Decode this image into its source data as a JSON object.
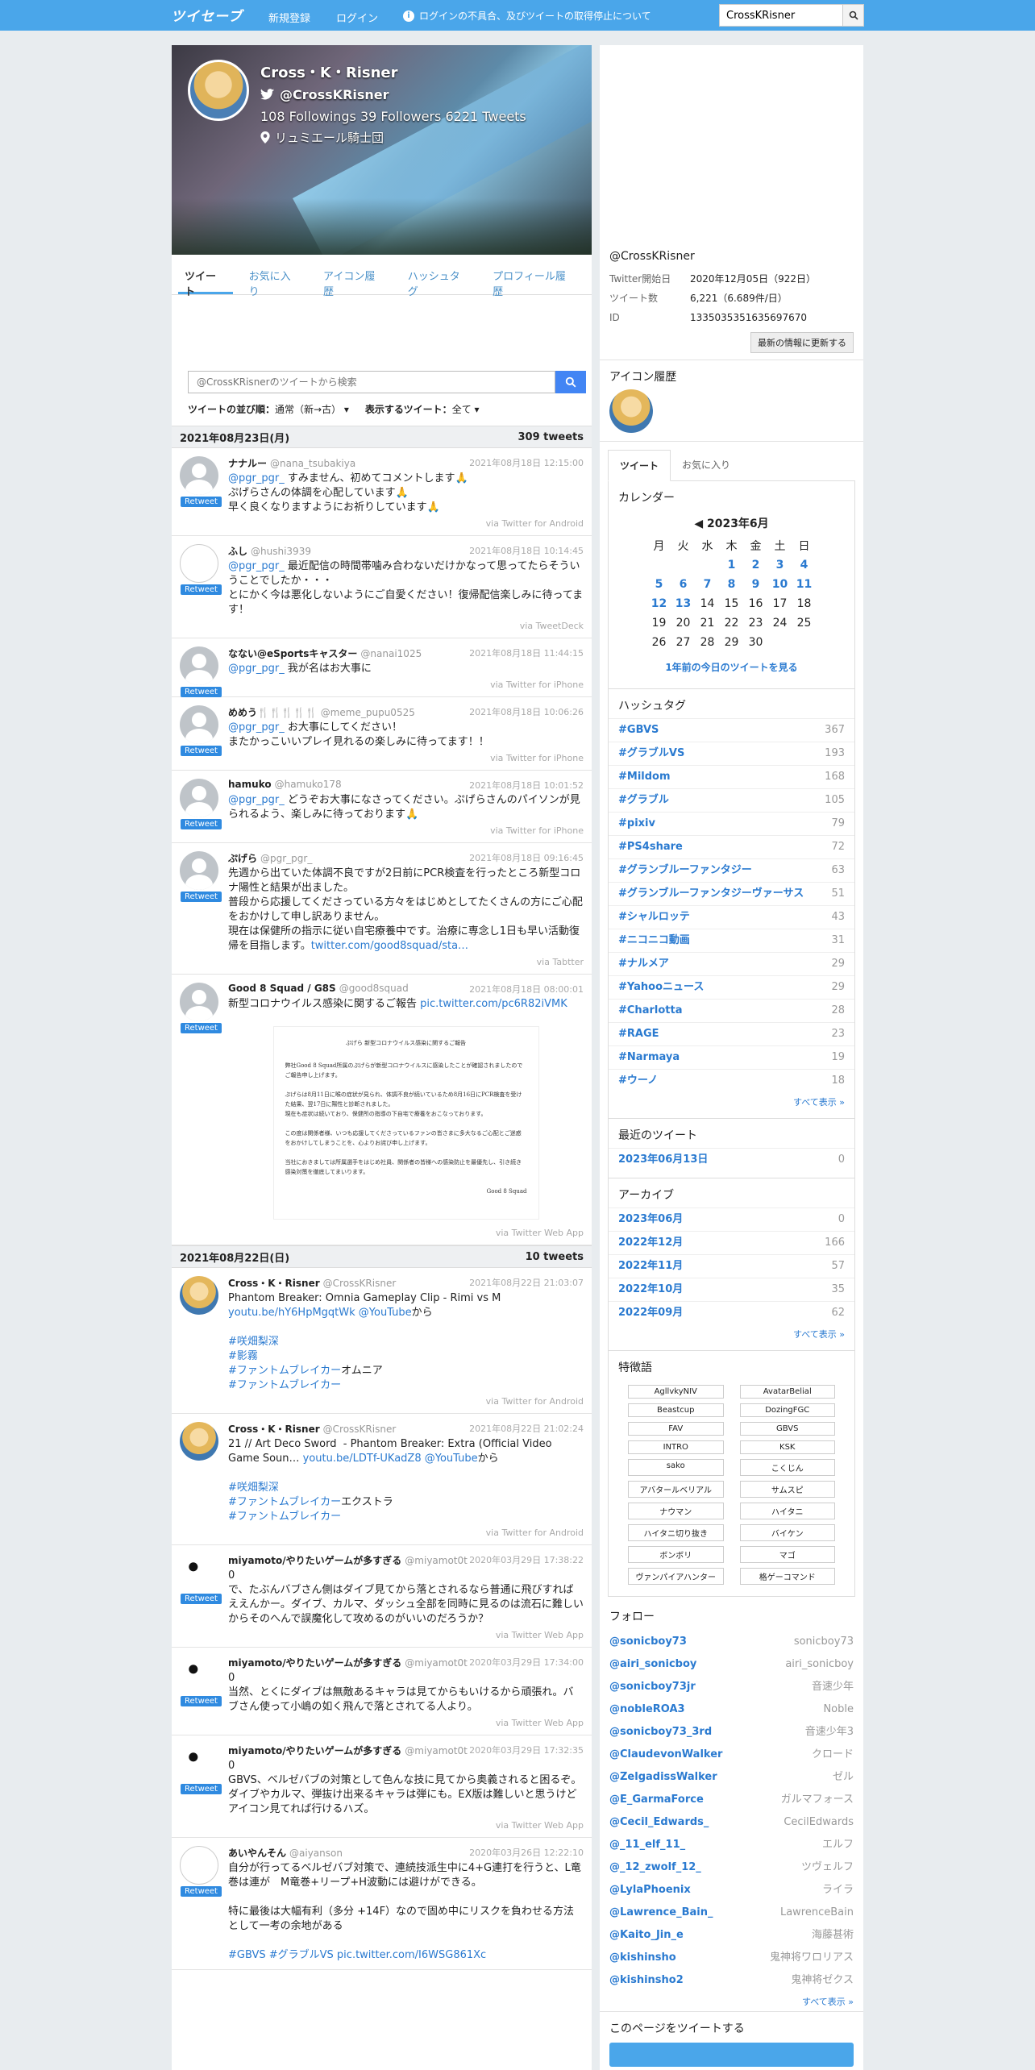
{
  "nav": {
    "logo": "ツイセーブ",
    "register": "新規登録",
    "login": "ログイン",
    "notice": "ログインの不具合、及びツイートの取得停止について",
    "search_value": "CrossKRisner"
  },
  "profile": {
    "name": "Cross・K・Risner",
    "handle": "@CrossKRisner",
    "stats": "108 Followings  39 Followers  6221 Tweets",
    "location": "リュミエール騎士団"
  },
  "tabs": [
    "ツイート",
    "お気に入り",
    "アイコン履歴",
    "ハッシュタグ",
    "プロフィール履歴"
  ],
  "search": {
    "placeholder": "@CrossKRisnerのツイートから検索"
  },
  "sort": {
    "order_label": "ツイートの並び順：",
    "order_value": "通常（新→古）",
    "show_label": "表示するツイート：",
    "show_value": "全て"
  },
  "day1": {
    "date": "2021年08月23日(月)",
    "count": "309 tweets"
  },
  "day2": {
    "date": "2021年08月22日(日)",
    "count": "10 tweets"
  },
  "tweets1": [
    {
      "name": "ナナルー",
      "user": "@nana_tsubakiya",
      "date": "2021年08月18日 12:15:00",
      "mention": "@pgr_pgr_",
      "text": " すみません、初めてコメントします🙏\nぷげらさんの体調を心配しています🙏\n早く良くなりますようにお祈りしています🙏",
      "via": "via Twitter for Android"
    },
    {
      "name": "ふし",
      "user": "@hushi3939",
      "date": "2021年08月18日 10:14:45",
      "mention": "@pgr_pgr_",
      "text": " 最近配信の時間帯噛み合わないだけかなって思ってたらそういうことでしたか・・・\nとにかく今は悪化しないようにご自愛ください！復帰配信楽しみに待ってます！",
      "via": "via TweetDeck"
    },
    {
      "name": "なない@eSportsキャスター",
      "user": "@nanai1025",
      "date": "2021年08月18日 11:44:15",
      "mention": "@pgr_pgr_",
      "text": " 我が名はお大事に",
      "via": "via Twitter for iPhone"
    },
    {
      "name": "めめう🍴🍴🍴🍴🍴",
      "user": "@meme_pupu0525",
      "date": "2021年08月18日 10:06:26",
      "mention": "@pgr_pgr_",
      "text": " お大事にしてください！\nまたかっこいいプレイ見れるの楽しみに待ってます！！",
      "via": "via Twitter for iPhone"
    },
    {
      "name": "hamuko",
      "user": "@hamuko178",
      "date": "2021年08月18日 10:01:52",
      "mention": "@pgr_pgr_",
      "text": " どうぞお大事になさってください。ぷげらさんのパイソンが見られるよう、楽しみに待っております🙏",
      "via": "via Twitter for iPhone"
    },
    {
      "name": "ぷげら",
      "user": "@pgr_pgr_",
      "date": "2021年08月18日 09:16:45",
      "mention": "",
      "text": "先週から出ていた体調不良ですが2日前にPCR検査を行ったところ新型コロナ陽性と結果が出ました。\n普段から応援してくださっている方々をはじめとしてたくさんの方にご心配をおかけして申し訳ありません。\n現在は保健所の指示に従い自宅療養中です。治療に専念し1日も早い活動復帰を目指します。",
      "link": "twitter.com/good8squad/sta…",
      "via": "via Tabtter"
    },
    {
      "name": "Good 8 Squad / G8S",
      "user": "@good8squad",
      "date": "2021年08月18日 08:00:01",
      "mention": "",
      "text": "新型コロナウイルス感染に関するご報告 ",
      "link": "pic.twitter.com/pc6R82iVMK",
      "via": "via Twitter Web App"
    }
  ],
  "doc": {
    "title": "ぷげら 新型コロナウイルス感染に関するご報告",
    "p1": "弊社Good 8 Squad所属のぷげらが新型コロナウイルスに感染したことが確認されましたのでご報告申し上げます。",
    "p2": "ぷげらは8月11日に喉の症状が見られ、体調不良が続いているため8月16日にPCR検査を受けた結果、翌17日に陽性と診断されました。\n現在も症状は続いており、保健所の指導の下自宅で療養をおこなっております。",
    "p3": "この度は関係者様、いつも応援してくださっているファンの皆さまに多大なるご心配とご迷惑をおかけしてしまうことを、心よりお詫び申し上げます。",
    "p4": "当社におきましては所属選手をはじめ社員、関係者の皆様への感染防止を最優先し、引き続き感染対策を徹底してまいります。",
    "sign": "Good 8 Squad"
  },
  "tweets2": [
    {
      "name": "Cross・K・Risner",
      "user": "@CrossKRisner",
      "date": "2021年08月22日 21:03:07",
      "text": "Phantom Breaker: Omnia Gameplay Clip - Rimi vs M ",
      "link": "youtu.be/hY6HpMgqtWk @YouTube",
      "after": "から\n\n",
      "tags": "#咲畑梨深\n#影霧\n#ファントムブレイカー",
      "tagsuffix": "オムニア",
      "tag2": "#ファントムブレイカー",
      "via": "via Twitter for Android"
    },
    {
      "name": "Cross・K・Risner",
      "user": "@CrossKRisner",
      "date": "2021年08月22日 21:02:24",
      "text": "21 // Art Deco Sword  - Phantom Breaker: Extra (Official Video Game Soun… ",
      "link": "youtu.be/LDTf-UKadZ8 @YouTube",
      "after": "から\n\n",
      "tags": "#咲畑梨深\n#ファントムブレイカー",
      "tagsuffix": "エクストラ",
      "tag2": "#ファントムブレイカー",
      "via": "via Twitter for Android"
    }
  ],
  "tweets3": [
    {
      "name": "miyamoto/やりたいゲームが多すぎる",
      "user": "@miyamot0t",
      "date": "2020年03月29日 17:38:22",
      "text": "0\nで、たぶんバブさん側はダイブ見てから落とされるなら普通に飛びすればええんかー。ダイブ、カルマ、ダッシュ全部を同時に見るのは流石に難しいからそのへんで誤魔化して攻めるのがいいのだろうか？",
      "via": "via Twitter Web App"
    },
    {
      "name": "miyamoto/やりたいゲームが多すぎる",
      "user": "@miyamot0t",
      "date": "2020年03月29日 17:34:00",
      "text": "0\n当然、とくにダイブは無敵あるキャラは見てからもいけるから頑張れ。バブさん使って小嶋の如く飛んで落とされてる人より。",
      "via": "via Twitter Web App"
    },
    {
      "name": "miyamoto/やりたいゲームが多すぎる",
      "user": "@miyamot0t",
      "date": "2020年03月29日 17:32:35",
      "text": "0\nGBVS、ベルゼバブの対策として色んな技に見てから奥義されると困るぞ。ダイブやカルマ、弾抜け出来るキャラは弾にも。EX版は難しいと思うけどアイコン見てれば行けるハズ。",
      "via": "via Twitter Web App"
    },
    {
      "name": "あいやんそん",
      "user": "@aiyanson",
      "date": "2020年03月26日 12:22:10",
      "text": "自分が行ってるベルゼバブ対策で、連続技派生中に4+G連打を行うと、L竜巻は連が　M竜巻+リープ+H波動には避けができる。\n\n特に最後は大幅有利（多分 +14F）なので固め中にリスクを負わせる方法として一考の余地がある\n\n",
      "link": "#GBVS #グラブルVS pic.twitter.com/I6WSG861Xc",
      "via": ""
    }
  ],
  "rt_label": "Retweet",
  "side": {
    "handle": "@CrossKRisner",
    "rows": [
      {
        "k": "Twitter開始日",
        "v": "2020年12月05日（922日）"
      },
      {
        "k": "ツイート数",
        "v": "6,221（6.689件/日）"
      },
      {
        "k": "ID",
        "v": "1335035351635697670"
      }
    ],
    "refresh": "最新の情報に更新する",
    "icon_hist": "アイコン履歴",
    "tabs": [
      "ツイート",
      "お気に入り"
    ],
    "cal_title": "カレンダー",
    "cal_month": "2023年6月",
    "weekdays": [
      "月",
      "火",
      "水",
      "木",
      "金",
      "土",
      "日"
    ],
    "cal_link": "1年前の今日のツイートを見る",
    "hash_title": "ハッシュタグ",
    "hashtags": [
      {
        "n": "#GBVS",
        "c": "367"
      },
      {
        "n": "#グラブルVS",
        "c": "193"
      },
      {
        "n": "#Mildom",
        "c": "168"
      },
      {
        "n": "#グラブル",
        "c": "105"
      },
      {
        "n": "#pixiv",
        "c": "79"
      },
      {
        "n": "#PS4share",
        "c": "72"
      },
      {
        "n": "#グランブルーファンタジー",
        "c": "63"
      },
      {
        "n": "#グランブルーファンタジーヴァーサス",
        "c": "51"
      },
      {
        "n": "#シャルロッテ",
        "c": "43"
      },
      {
        "n": "#ニコニコ動画",
        "c": "31"
      },
      {
        "n": "#ナルメア",
        "c": "29"
      },
      {
        "n": "#Yahooニュース",
        "c": "29"
      },
      {
        "n": "#Charlotta",
        "c": "28"
      },
      {
        "n": "#RAGE",
        "c": "23"
      },
      {
        "n": "#Narmaya",
        "c": "19"
      },
      {
        "n": "#ウーノ",
        "c": "18"
      }
    ],
    "show_all": "すべて表示 »",
    "recent_title": "最近のツイート",
    "recent": [
      {
        "n": "2023年06月13日",
        "c": "0"
      }
    ],
    "archive_title": "アーカイブ",
    "archive": [
      {
        "n": "2023年06月",
        "c": "0"
      },
      {
        "n": "2022年12月",
        "c": "166"
      },
      {
        "n": "2022年11月",
        "c": "57"
      },
      {
        "n": "2022年10月",
        "c": "35"
      },
      {
        "n": "2022年09月",
        "c": "62"
      }
    ],
    "words_title": "特徴語",
    "words": [
      "AgllvkyNIV",
      "AvatarBelial",
      "Beastcup",
      "DozingFGC",
      "FAV",
      "GBVS",
      "INTRO",
      "KSK",
      "sako",
      "こくじん",
      "アバタールベリアル",
      "サムスピ",
      "ナウマン",
      "ハイタニ",
      "ハイタニ切り抜き",
      "バイケン",
      "ボンボリ",
      "マゴ",
      "ヴァンパイアハンター",
      "格ゲーコマンド"
    ],
    "follow_title": "フォロー",
    "follows": [
      {
        "n": "@sonicboy73",
        "c": "sonicboy73"
      },
      {
        "n": "@airi_sonicboy",
        "c": "airi_sonicboy"
      },
      {
        "n": "@sonicboy73jr",
        "c": "音速少年"
      },
      {
        "n": "@nobleROA3",
        "c": "Noble"
      },
      {
        "n": "@sonicboy73_3rd",
        "c": "音速少年3"
      },
      {
        "n": "@ClaudevonWalker",
        "c": "クロード"
      },
      {
        "n": "@ZelgadissWalker",
        "c": "ゼル"
      },
      {
        "n": "@E_GarmaForce",
        "c": "ガルマフォース"
      },
      {
        "n": "@Cecil_Edwards_",
        "c": "CecilEdwards"
      },
      {
        "n": "@_11_elf_11_",
        "c": "エルフ"
      },
      {
        "n": "@_12_zwolf_12_",
        "c": "ツヴェルフ"
      },
      {
        "n": "@LylaPhoenix",
        "c": "ライラ"
      },
      {
        "n": "@Lawrence_Bain_",
        "c": "LawrenceBain"
      },
      {
        "n": "@Kaito_Jin_e",
        "c": "海藤甚術"
      },
      {
        "n": "@kishinsho",
        "c": "鬼神将ワロリアス"
      },
      {
        "n": "@kishinsho2",
        "c": "鬼神将ゼクス"
      }
    ],
    "share_title": "このページをツイートする"
  }
}
